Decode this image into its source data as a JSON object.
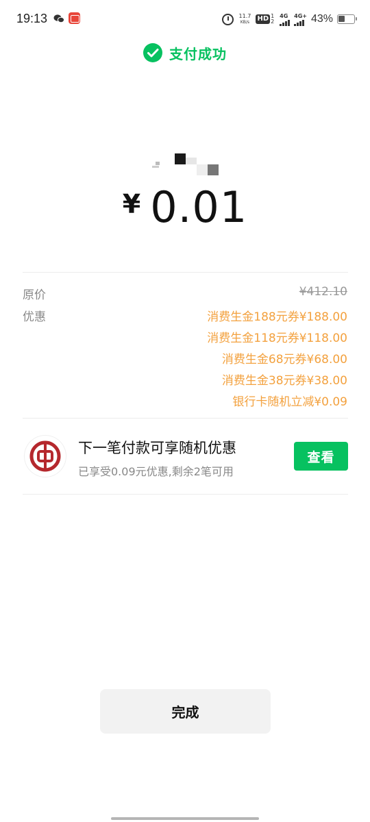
{
  "status_bar": {
    "time": "19:13",
    "net_speed_value": "11.7",
    "net_speed_unit": "KB/s",
    "hd_label": "HD",
    "hd_sub": "1 2",
    "signal1_label": "4G",
    "signal2_label": "4G+",
    "battery_percent": "43%"
  },
  "header": {
    "title": "支付成功",
    "accent_color": "#07c160"
  },
  "payment": {
    "currency_symbol": "¥",
    "amount": "0.01"
  },
  "details": {
    "original_price_label": "原价",
    "original_price": "¥412.10",
    "discount_label": "优惠",
    "discounts": [
      "消费生金188元券¥188.00",
      "消费生金118元券¥118.00",
      "消费生金68元券¥68.00",
      "消费生金38元券¥38.00",
      "银行卡随机立减¥0.09"
    ],
    "discount_color": "#f3a13e"
  },
  "promo": {
    "bank_icon": "bank-of-china-logo",
    "title": "下一笔付款可享随机优惠",
    "subtitle": "已享受0.09元优惠,剩余2笔可用",
    "button_label": "查看"
  },
  "footer": {
    "done_label": "完成"
  }
}
